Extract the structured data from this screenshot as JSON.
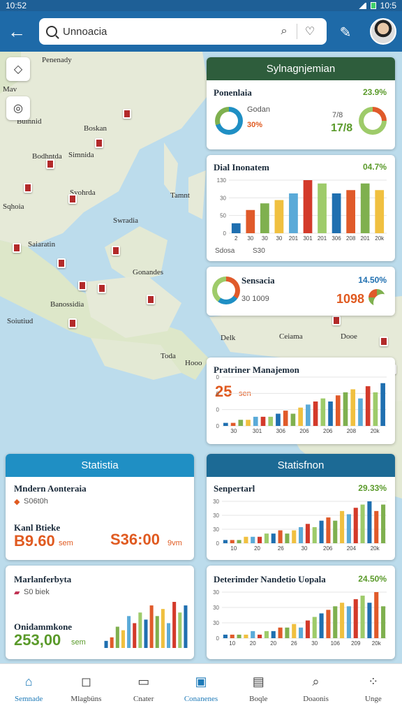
{
  "status": {
    "time": "10:52",
    "clock_right": "10:5"
  },
  "appbar": {
    "search_value": "Unnoacia"
  },
  "map": {
    "labels": [
      "Penenady",
      "Mav",
      "Boskan",
      "Bodhntda",
      "Simnida",
      "Syohrda",
      "Sqhoia",
      "Swradia",
      "Saiaratin",
      "Banossidia",
      "Gonandes",
      "Toda",
      "Hooo",
      "Ceiama",
      "Delk",
      "Dooe",
      "Buinnid",
      "Tamnt",
      "Soiutiud"
    ]
  },
  "cards": {
    "mgmt": {
      "header": "Sylnagnjemian",
      "title": "Ponenlaia",
      "pct": "23.9%",
      "left_small": "Godan",
      "left_val": "30%",
      "right_small": "7/8",
      "right_val": "17/8"
    },
    "dial": {
      "title": "Dial Inonatem",
      "pct": "04.7%",
      "legend": [
        "Sdosa",
        "S30"
      ],
      "chart": {
        "type": "bar",
        "categories": [
          "2",
          "30",
          "30",
          "30",
          "201",
          "301",
          "201",
          "306",
          "208",
          "201",
          "20k"
        ],
        "series": [
          {
            "values": [
              3,
              7,
              9,
              10,
              12,
              16,
              15,
              12,
              13,
              15,
              13
            ]
          },
          {
            "values": [
              0,
              0,
              0,
              8,
              0,
              14,
              0,
              0,
              14,
              0,
              0
            ]
          }
        ],
        "ylim": [
          0,
          16
        ],
        "yticks": [
          "130",
          "30",
          "50",
          "0"
        ]
      }
    },
    "sensacia": {
      "title": "Sensacia",
      "pct": "14.50%",
      "sub": "30 1009",
      "value": "1098"
    },
    "pratner": {
      "title": "Pratriner Manajemon",
      "big": "25",
      "big_suffix": "sen",
      "chart": {
        "type": "bar",
        "categories": [
          "30",
          "301",
          "306",
          "206",
          "206",
          "208",
          "20k"
        ],
        "values": [
          1,
          1,
          2,
          2,
          3,
          3,
          3,
          4,
          5,
          4,
          6,
          7,
          8,
          9,
          8,
          10,
          11,
          12,
          9,
          13,
          11,
          14
        ],
        "ylim": [
          0,
          16
        ],
        "yticks": [
          "0",
          "0",
          "0",
          "0"
        ]
      }
    },
    "stat_left": {
      "header": "Statistia",
      "title": "Mndern Aonteraia",
      "sub": "S06t0h",
      "label": "Kanl Btieke",
      "val_left": "B9.60",
      "val_left_unit": "sem",
      "val_right": "S36:00",
      "val_right_unit": "9vm"
    },
    "stat_left2": {
      "title": "Marlanferbyta",
      "sub": "S0 biek",
      "label": "Onidammkone",
      "value": "253,00",
      "value_unit": "sem",
      "chart": {
        "type": "bar",
        "values": [
          2,
          3,
          6,
          5,
          9,
          7,
          10,
          8,
          12,
          9,
          11,
          7,
          13,
          10,
          12
        ]
      }
    },
    "stat_right": {
      "header": "Statisfnon",
      "title": "Senpertarl",
      "pct": "29.33%",
      "chart": {
        "type": "bar",
        "categories": [
          "10",
          "20",
          "26",
          "30",
          "206",
          "204",
          "20k"
        ],
        "values": [
          1,
          1,
          1,
          2,
          2,
          2,
          3,
          3,
          4,
          3,
          4,
          5,
          6,
          5,
          7,
          8,
          7,
          10,
          9,
          11,
          12,
          13,
          10,
          12
        ],
        "yticks": [
          "30",
          "30",
          "30",
          "0"
        ]
      }
    },
    "stat_right2": {
      "title": "Deterimder Nandetio Uopala",
      "pct": "24.50%",
      "chart": {
        "type": "bar",
        "categories": [
          "10",
          "20",
          "20",
          "26",
          "30",
          "106",
          "209",
          "20k"
        ],
        "values": [
          1,
          1,
          1,
          1,
          2,
          1,
          2,
          2,
          3,
          3,
          4,
          3,
          5,
          6,
          7,
          8,
          9,
          10,
          9,
          11,
          12,
          10,
          13,
          9
        ],
        "yticks": [
          "30",
          "30",
          "30",
          "0"
        ]
      }
    }
  },
  "nav": [
    "Semnade",
    "Mlagbüns",
    "Cnater",
    "Conanenes",
    "Boqle",
    "Doaonis",
    "Unge"
  ],
  "colors": [
    "#1f6fb0",
    "#e05a2a",
    "#7fb04f",
    "#f0c040",
    "#5aaad8",
    "#d33a2a",
    "#9ecb6a"
  ]
}
